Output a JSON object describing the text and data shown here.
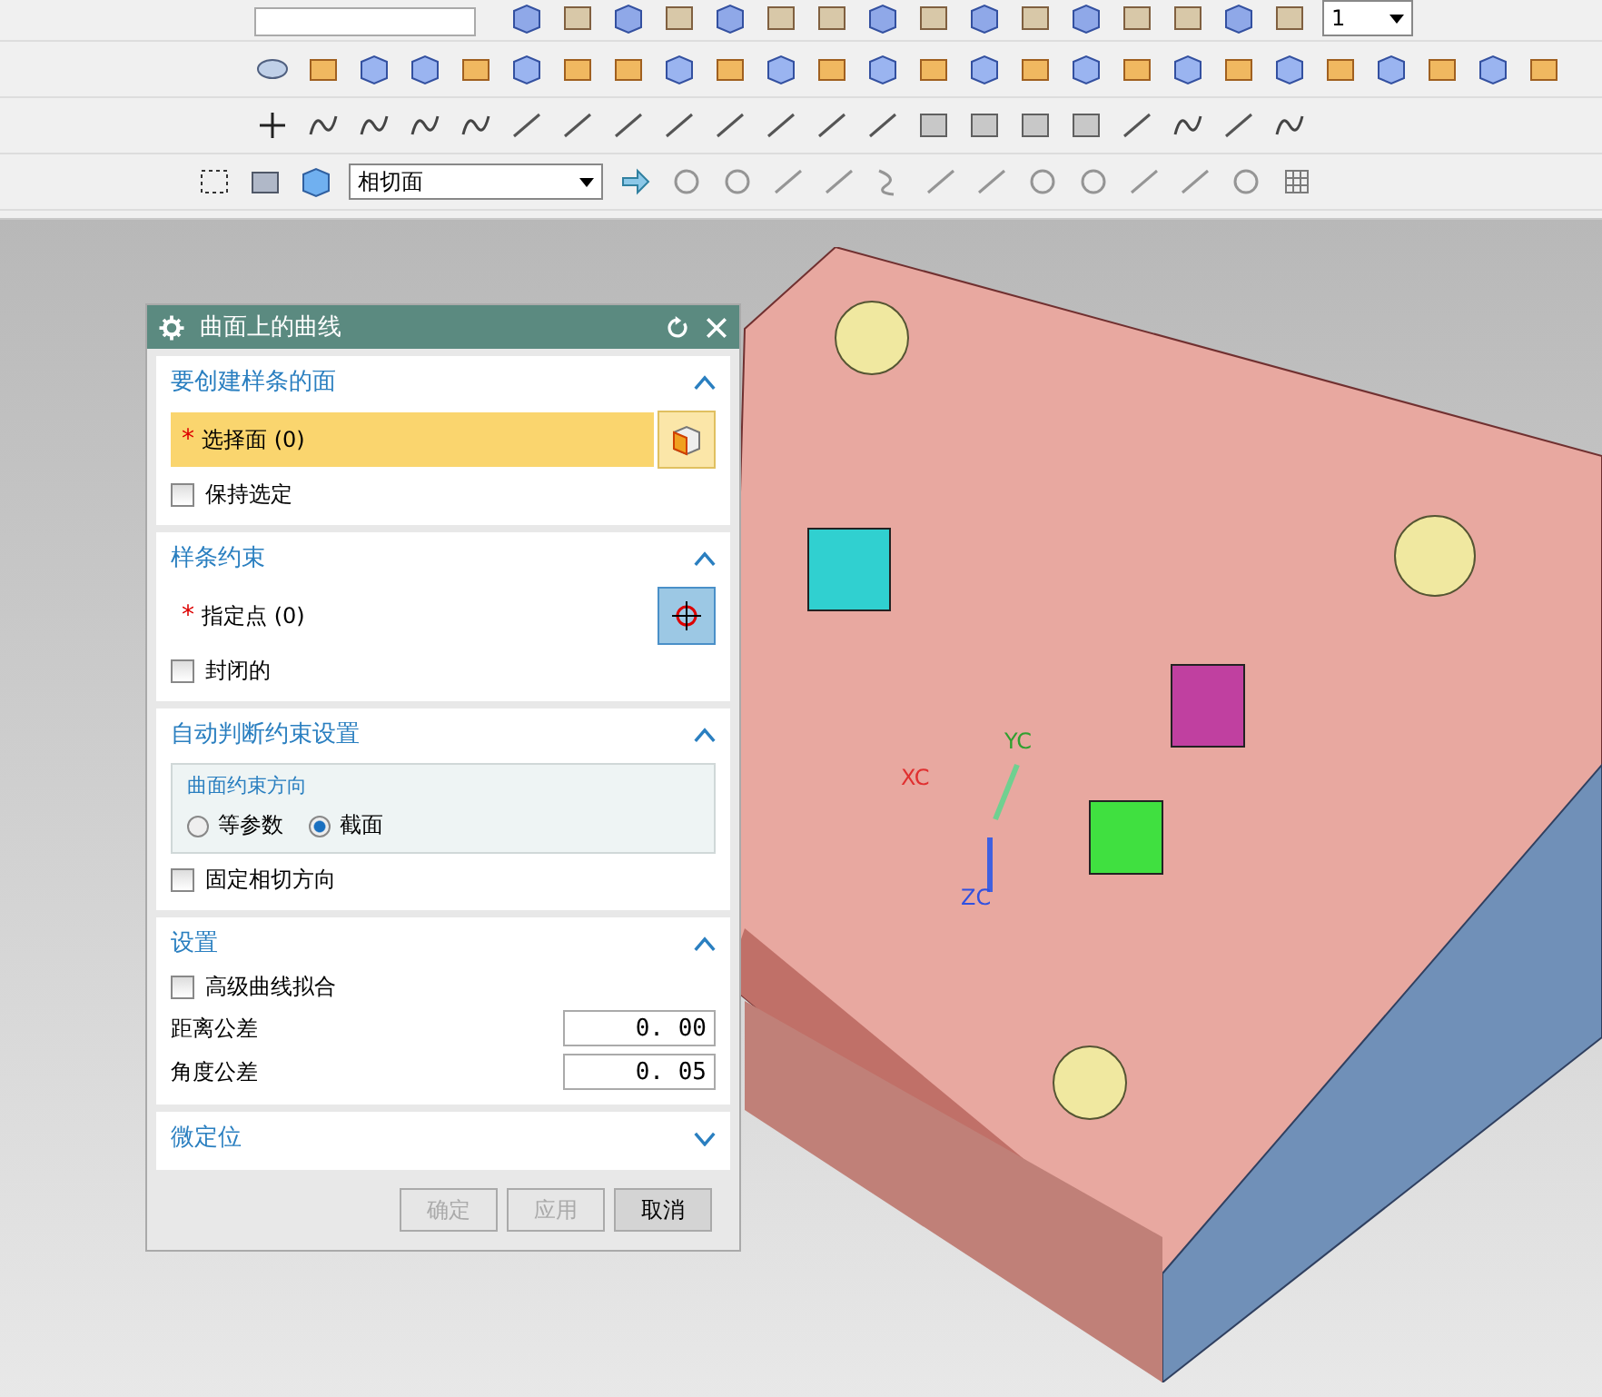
{
  "toolbar": {
    "layer_value": "1",
    "filter_value": "相切面"
  },
  "viewport": {
    "axis_labels": [
      {
        "text": "XC",
        "color": "#e03030"
      },
      {
        "text": "YC",
        "color": "#30a030"
      },
      {
        "text": "ZC",
        "color": "#3050e0"
      }
    ]
  },
  "dialog": {
    "title": "曲面上的曲线",
    "sections": [
      {
        "title": "要创建样条的面",
        "expanded": true,
        "items": [
          {
            "kind": "selection",
            "marker": "*",
            "label": "选择面 (0)",
            "selected": true
          },
          {
            "kind": "checkbox",
            "label": "保持选定",
            "checked": false
          }
        ]
      },
      {
        "title": "样条约束",
        "expanded": true,
        "items": [
          {
            "kind": "point",
            "marker": "*",
            "label": "指定点 (0)",
            "selected": false
          },
          {
            "kind": "checkbox",
            "label": "封闭的",
            "checked": false
          }
        ]
      },
      {
        "title": "自动判断约束设置",
        "expanded": true,
        "items": [
          {
            "kind": "group",
            "label": "曲面约束方向",
            "options": [
              {
                "label": "等参数",
                "selected": false
              },
              {
                "label": "截面",
                "selected": true
              }
            ]
          },
          {
            "kind": "checkbox",
            "label": "固定相切方向",
            "checked": false
          }
        ]
      },
      {
        "title": "设置",
        "expanded": true,
        "items": [
          {
            "kind": "checkbox",
            "label": "高级曲线拟合",
            "checked": false
          },
          {
            "kind": "field",
            "label": "距离公差",
            "value": "0. 00"
          },
          {
            "kind": "field",
            "label": "角度公差",
            "value": "0. 05"
          }
        ]
      },
      {
        "title": "微定位",
        "expanded": false
      }
    ],
    "buttons": [
      {
        "label": "确定",
        "disabled": true
      },
      {
        "label": "应用",
        "disabled": true
      },
      {
        "label": "取消",
        "disabled": false
      }
    ]
  }
}
